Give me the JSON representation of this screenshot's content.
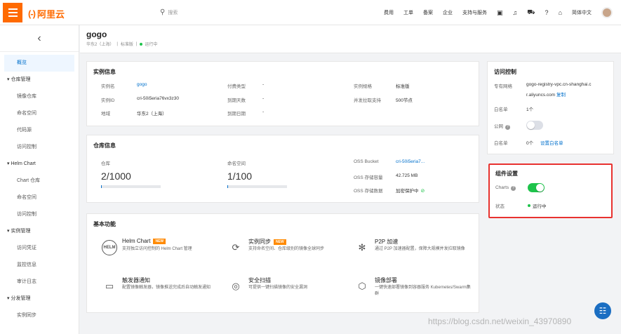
{
  "topbar": {
    "logo_text": "阿里云",
    "search_placeholder": "搜索",
    "nav_items": [
      "费用",
      "工单",
      "备案",
      "企业",
      "支持与服务"
    ],
    "language": "简体中文",
    "icons": [
      "terminal-icon",
      "bell-icon",
      "cart-icon",
      "help-icon",
      "home-icon"
    ]
  },
  "sidebar": {
    "back_icon": "‹",
    "items": [
      {
        "label": "概览",
        "type": "item",
        "active": true
      },
      {
        "label": "仓库管理",
        "type": "group"
      },
      {
        "label": "镜像仓库",
        "type": "item"
      },
      {
        "label": "命名空间",
        "type": "item"
      },
      {
        "label": "代码源",
        "type": "item"
      },
      {
        "label": "访问控制",
        "type": "item"
      },
      {
        "label": "Helm Chart",
        "type": "group"
      },
      {
        "label": "Chart 仓库",
        "type": "item"
      },
      {
        "label": "命名空间",
        "type": "item"
      },
      {
        "label": "访问控制",
        "type": "item"
      },
      {
        "label": "实例管理",
        "type": "group"
      },
      {
        "label": "访问凭证",
        "type": "item"
      },
      {
        "label": "监控信息",
        "type": "item"
      },
      {
        "label": "审计日志",
        "type": "item"
      },
      {
        "label": "分发管理",
        "type": "group"
      },
      {
        "label": "实例同步",
        "type": "item"
      }
    ]
  },
  "header": {
    "title": "gogo",
    "region": "华东2（上海）",
    "edition": "标准版",
    "status": "运行中",
    "sep": "|"
  },
  "instance_info": {
    "title": "实例信息",
    "name_label": "实例名",
    "name_value": "gogo",
    "id_label": "实例ID",
    "id_value": "cri-50i5eria76vx3z30",
    "region_label": "地域",
    "region_value": "华东2（上海）",
    "billing_label": "付费类型",
    "billing_value": "-",
    "expire_label": "到期天数",
    "expire_value": "-",
    "expire_date_label": "到期日期",
    "expire_date_value": "-",
    "spec_label": "实例规格",
    "spec_value": "标准版",
    "pull_label": "并发拉取支持",
    "pull_value": "500节点"
  },
  "repo_info": {
    "title": "仓库信息",
    "repo_label": "仓库",
    "repo_value": "2/1000",
    "repo_fraction": 0.002,
    "ns_label": "命名空间",
    "ns_value": "1/100",
    "ns_fraction": 0.01,
    "oss_bucket_label": "OSS Bucket",
    "oss_bucket_value": "cri-50i5eria7...",
    "oss_size_label": "OSS 存储容量",
    "oss_size_value": "42.725 MB",
    "oss_data_label": "OSS 存储数据",
    "oss_data_value": "加密保护中"
  },
  "features": {
    "title": "基本功能",
    "new_badge": "NEW",
    "items": [
      {
        "name": "Helm Chart",
        "desc": "支持独立访问控制的 Helm Chart 管理",
        "icon": "helm-icon",
        "icon_text": "HELM",
        "new": true
      },
      {
        "name": "实例同步",
        "desc": "支持命名空间、仓库级别的镜像全球同步",
        "icon": "sync-icon",
        "new": true
      },
      {
        "name": "P2P 加速",
        "desc": "通过 P2P 加速器配置，保障大规模并发拉取镜像",
        "icon": "p2p-icon",
        "new": false
      },
      {
        "name": "触发器通知",
        "desc": "配置镜像触发器，镜像推送完成后自动触发通知",
        "icon": "message-icon",
        "new": false
      },
      {
        "name": "安全扫描",
        "desc": "可提供一键扫描镜像的安全漏洞",
        "icon": "scan-icon",
        "new": false
      },
      {
        "name": "镜像部署",
        "desc": "一键快速部署镜像到容器服务 Kubernetes/Swarm集群",
        "icon": "deploy-icon",
        "new": false
      }
    ]
  },
  "access_control": {
    "title": "访问控制",
    "vpc_label": "专有网络",
    "vpc_value": "gogo-registry-vpc.cn-shanghai.c",
    "vpc_value2": "r.aliyuncs.com",
    "copy_label": "复制",
    "whitelist_label": "白名单",
    "whitelist_value": "1个",
    "public_label": "公网",
    "public_enabled": false,
    "whitelist2_label": "白名单",
    "whitelist2_value": "0个",
    "whitelist2_link": "设置白名单"
  },
  "component_settings": {
    "title": "组件设置",
    "charts_label": "Charts",
    "charts_enabled": true,
    "status_label": "状态",
    "status_value": "运行中"
  },
  "watermark": "https://blog.csdn.net/weixin_43970890",
  "colors": {
    "brand": "#ff6a00",
    "link": "#0070cc",
    "running": "#1ec34b",
    "highlight": "#e8322f"
  }
}
